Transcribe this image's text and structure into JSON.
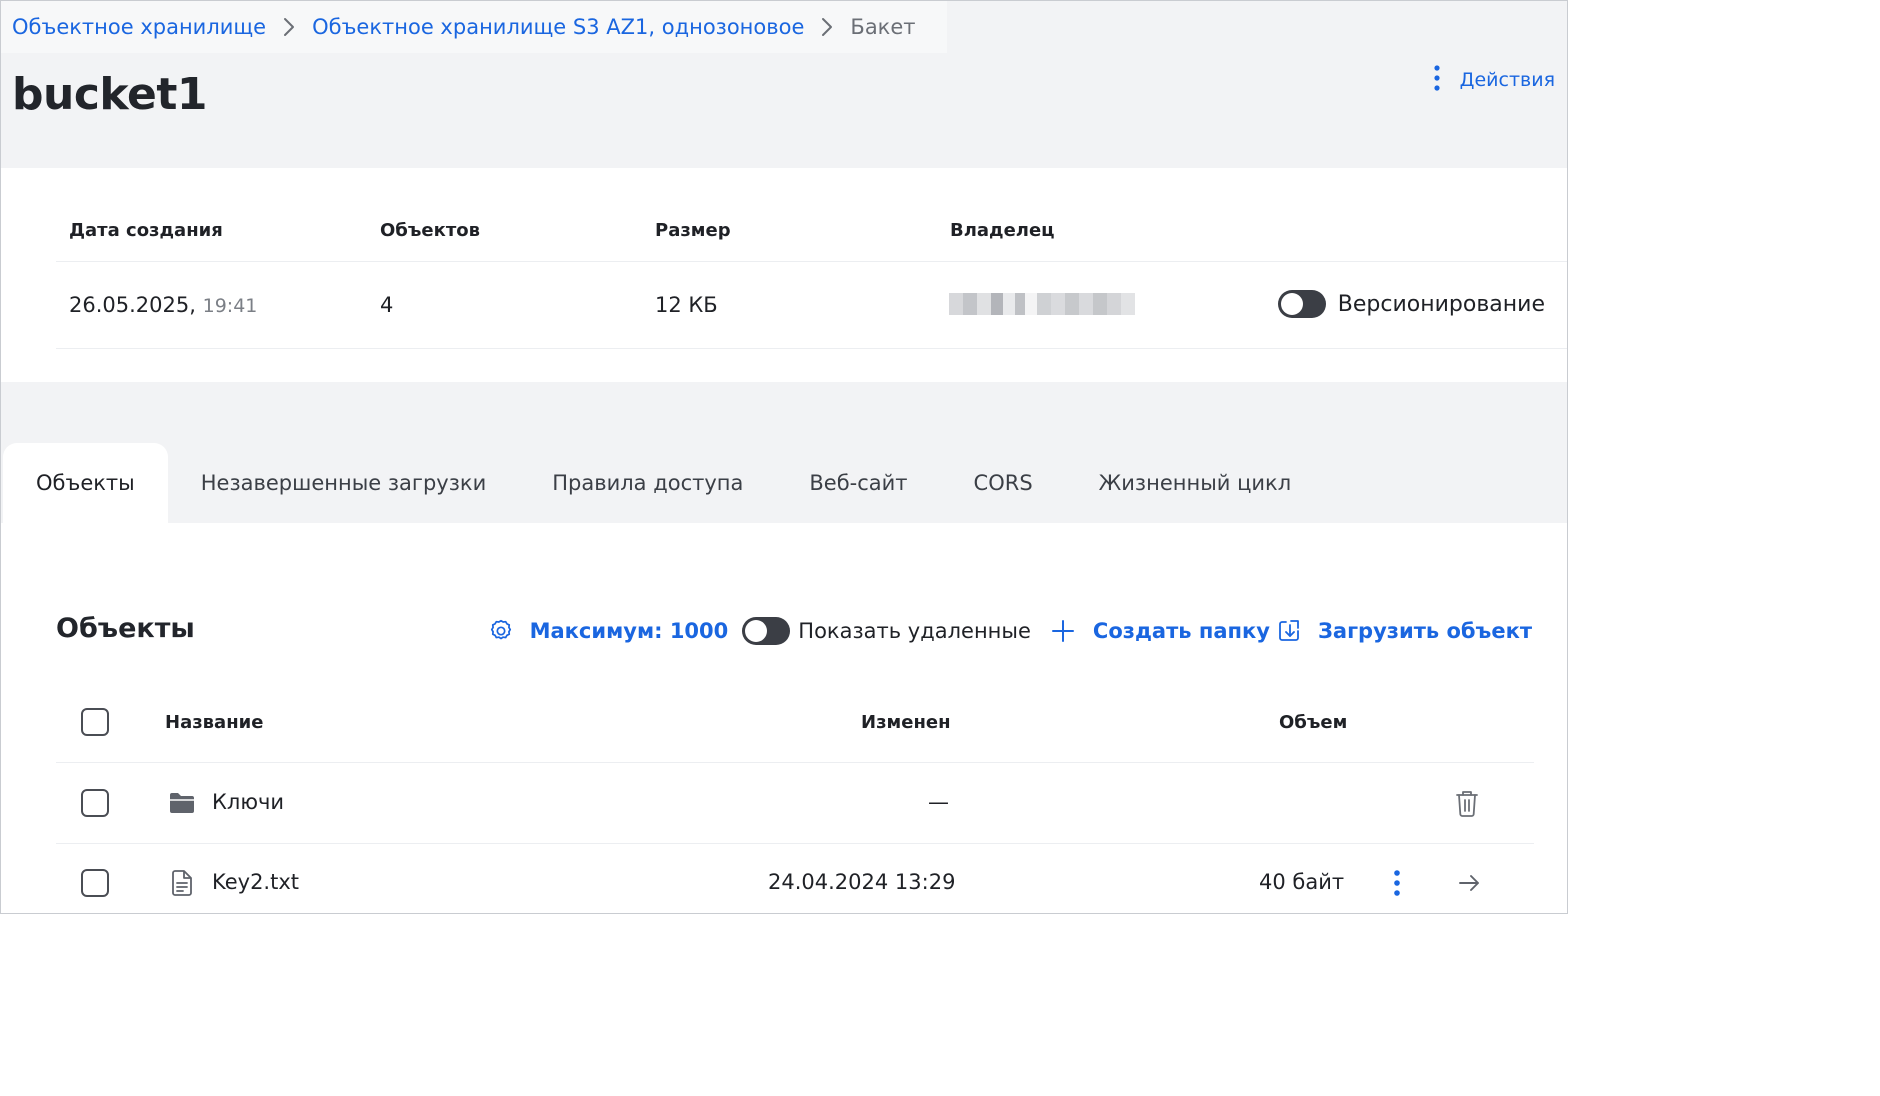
{
  "breadcrumb": {
    "items": [
      {
        "label": "Объектное хранилище"
      },
      {
        "label": "Объектное хранилище S3 AZ1, однозоновое"
      },
      {
        "label": "Бакет"
      }
    ]
  },
  "page": {
    "title": "bucket1",
    "actions_label": "Действия"
  },
  "info": {
    "headers": {
      "created": "Дата создания",
      "objects": "Объектов",
      "size": "Размер",
      "owner": "Владелец"
    },
    "values": {
      "created_date": "26.05.2025,",
      "created_time": "19:41",
      "objects": "4",
      "size": "12 КБ"
    },
    "versioning_label": "Версионирование",
    "versioning_enabled": false
  },
  "tabs": [
    {
      "label": "Объекты",
      "active": true
    },
    {
      "label": "Незавершенные загрузки",
      "active": false
    },
    {
      "label": "Правила доступа",
      "active": false
    },
    {
      "label": "Веб-сайт",
      "active": false
    },
    {
      "label": "CORS",
      "active": false
    },
    {
      "label": "Жизненный цикл",
      "active": false
    }
  ],
  "objects_section": {
    "title": "Объекты",
    "max_label": "Максимум: 1000",
    "show_deleted_label": "Показать удаленные",
    "show_deleted_enabled": false,
    "create_folder_label": "Создать папку",
    "upload_label": "Загрузить объект"
  },
  "table": {
    "columns": {
      "name": "Название",
      "modified": "Изменен",
      "size": "Объем"
    },
    "rows": [
      {
        "type": "folder",
        "icon": "folder-icon",
        "name": "Ключи",
        "modified": "—",
        "size": ""
      },
      {
        "type": "file",
        "icon": "file-icon",
        "name": "Key2.txt",
        "modified": "24.04.2024 13:29",
        "size": "40 байт"
      }
    ]
  },
  "colors": {
    "accent": "#1a66e0",
    "header_bg": "#f2f3f5",
    "toggle_off": "#3b3e45"
  }
}
